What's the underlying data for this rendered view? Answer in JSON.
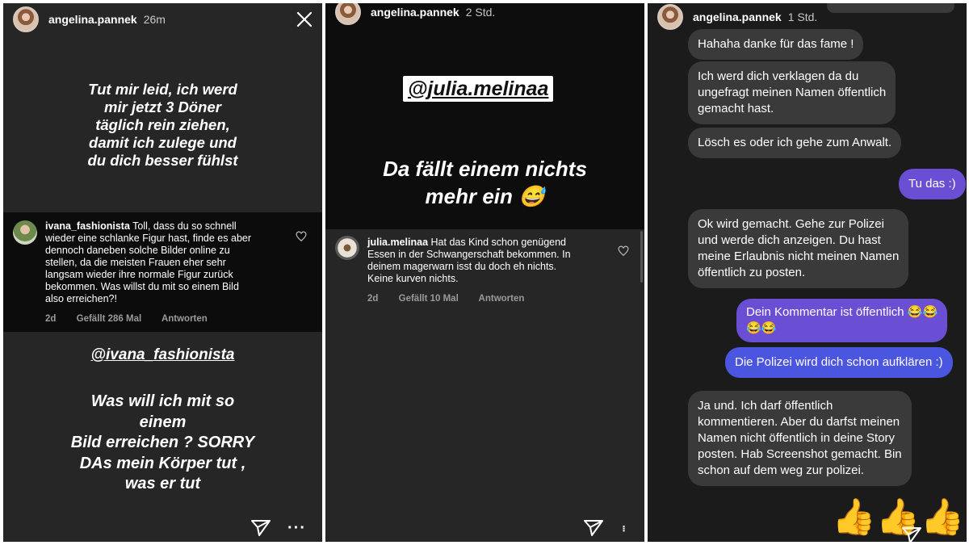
{
  "panel1": {
    "username": "angelina.pannek",
    "time": "26m",
    "story_text": [
      "Tut mir leid, ich werd",
      "mir jetzt 3 Döner",
      "täglich rein ziehen,",
      "damit ich zulege und",
      "du dich besser fühlst"
    ],
    "comment": {
      "username": "ivana_fashionista",
      "lines": [
        "Toll, dass du so schnell",
        "wieder eine schlanke Figur hast, finde es aber",
        "dennoch daneben solche Bilder online zu",
        "stellen, da die meisten Frauen eher sehr",
        "langsam wieder ihre normale Figur zurück",
        "bekommen. Was willst du mit so einem Bild",
        "also erreichen?!"
      ],
      "age": "2d",
      "likes": "Gefällt 286 Mal",
      "reply": "Antworten"
    },
    "mention": "@ivana_fashionista",
    "reply_text": [
      "Was will ich mit so",
      "einem",
      "Bild erreichen ? SORRY",
      "DAs mein Körper tut ,",
      "was er tut"
    ]
  },
  "panel2": {
    "username": "angelina.pannek",
    "time": "2 Std.",
    "mention": "@julia.melinaa",
    "story_text": [
      "Da fällt einem nichts",
      "mehr ein 😅"
    ],
    "comment": {
      "username": "julia.melinaa",
      "lines": [
        "Hat das Kind schon genügend",
        "Essen in der Schwangerschaft bekommen. In",
        "deinem magerwarn isst du doch eh nichts.",
        "Keine kurven nichts."
      ],
      "age": "2d",
      "likes": "Gefällt 10 Mal",
      "reply": "Antworten"
    }
  },
  "panel3": {
    "username": "angelina.pannek",
    "time": "1 Std.",
    "messages": {
      "m1": "Hahaha danke für das fame !",
      "m2": [
        "Ich werd dich verklagen da du",
        "ungefragt meinen Namen öffentlich",
        "gemacht hast."
      ],
      "m3": "Lösch es oder ich gehe zum Anwalt.",
      "m4": "Tu das :)",
      "m5": [
        "Ok wird gemacht. Gehe zur Polizei",
        "und werde dich anzeigen. Du hast",
        "meine Erlaubnis nicht meinen Namen",
        "öffentlich zu posten."
      ],
      "m6": [
        "Dein Kommentar ist öffentlich 😂😂",
        "😂😂"
      ],
      "m7": "Die Polizei wird dich schon aufklären :)",
      "m8": [
        "Ja und. Ich darf öffentlich",
        "kommentieren. Aber du darfst meinen",
        "Namen nicht öffentlich in deine Story",
        "posten. Hab Screenshot gemacht. Bin",
        "schon auf dem weg zur polizei."
      ]
    },
    "thumbs": "👍👍👍"
  },
  "colors": {
    "sent_purple": "#6a4fd4",
    "sent_blue": "#4a56e0",
    "received_gray": "#3a3a3a"
  }
}
